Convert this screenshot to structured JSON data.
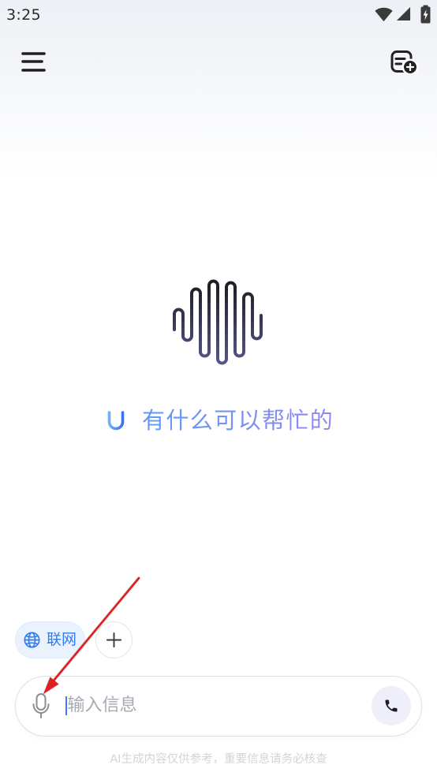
{
  "status_bar": {
    "time": "3:25",
    "icons": {
      "wifi": "wifi-icon",
      "signal": "cellular-signal-icon",
      "battery": "battery-charging-icon"
    }
  },
  "header": {
    "menu_icon": "menu-icon",
    "new_chat_icon": "new-chat-icon"
  },
  "hero": {
    "logo_icon": "waveform-logo-icon",
    "greeting_icon": "smile-icon",
    "greeting": "有什么可以帮忙的"
  },
  "chips": {
    "web_search": {
      "label": "联网",
      "icon": "globe-icon",
      "active": true
    },
    "more": {
      "icon": "plus-icon"
    }
  },
  "composer": {
    "mic_icon": "microphone-icon",
    "placeholder": "输入信息",
    "call_icon": "phone-icon"
  },
  "footer": {
    "disclaimer": "AI生成内容仅供参考，重要信息请务必核查"
  },
  "colors": {
    "accent": "#2f7bef",
    "chip_bg": "#eaf2fd",
    "greeting_start": "#5e9bf5",
    "greeting_end": "#9387f1",
    "call_button_bg": "#eeeffa",
    "annotation_arrow": "#e0201e"
  }
}
